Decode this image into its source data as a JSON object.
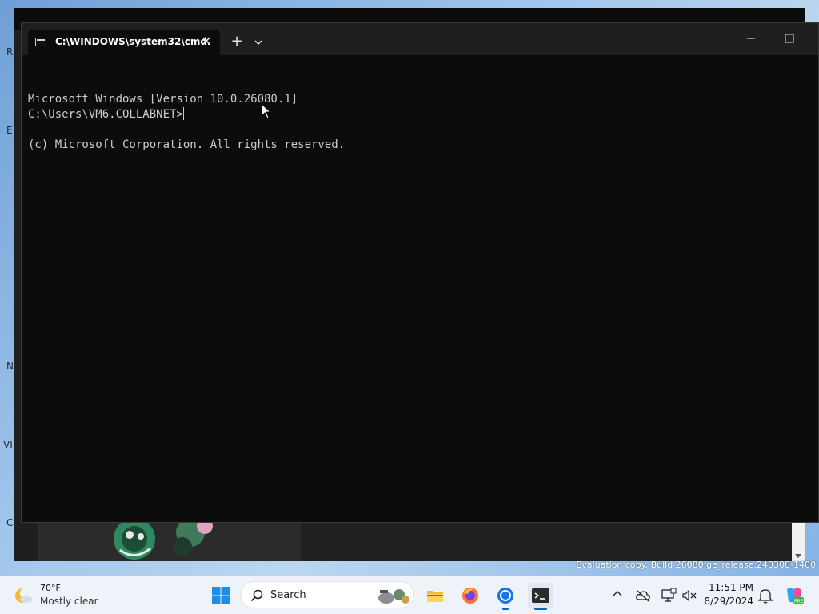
{
  "desktop": {
    "edge_letters": [
      "R",
      "E",
      "N",
      "VI",
      "C"
    ],
    "evaluation_text": "Evaluation copy. Build 26080.ge_release.240308-1400"
  },
  "terminal": {
    "tab_title": "C:\\WINDOWS\\system32\\cmd.",
    "close_symbol": "✕",
    "new_tab_symbol": "+",
    "lines": [
      "Microsoft Windows [Version 10.0.26080.1]",
      "(c) Microsoft Corporation. All rights reserved."
    ],
    "prompt": "C:\\Users\\VM6.COLLABNET>"
  },
  "taskbar": {
    "weather_temp": "70°F",
    "weather_desc": "Mostly clear",
    "search_placeholder": "Search",
    "time": "11:51 PM",
    "date": "8/29/2024"
  },
  "colors": {
    "terminal_bg": "#0c0c0c",
    "terminal_text": "#cccccc",
    "titlebar": "#1f1f1f",
    "taskbar": "#eef3f9",
    "accent": "#0067c0"
  }
}
